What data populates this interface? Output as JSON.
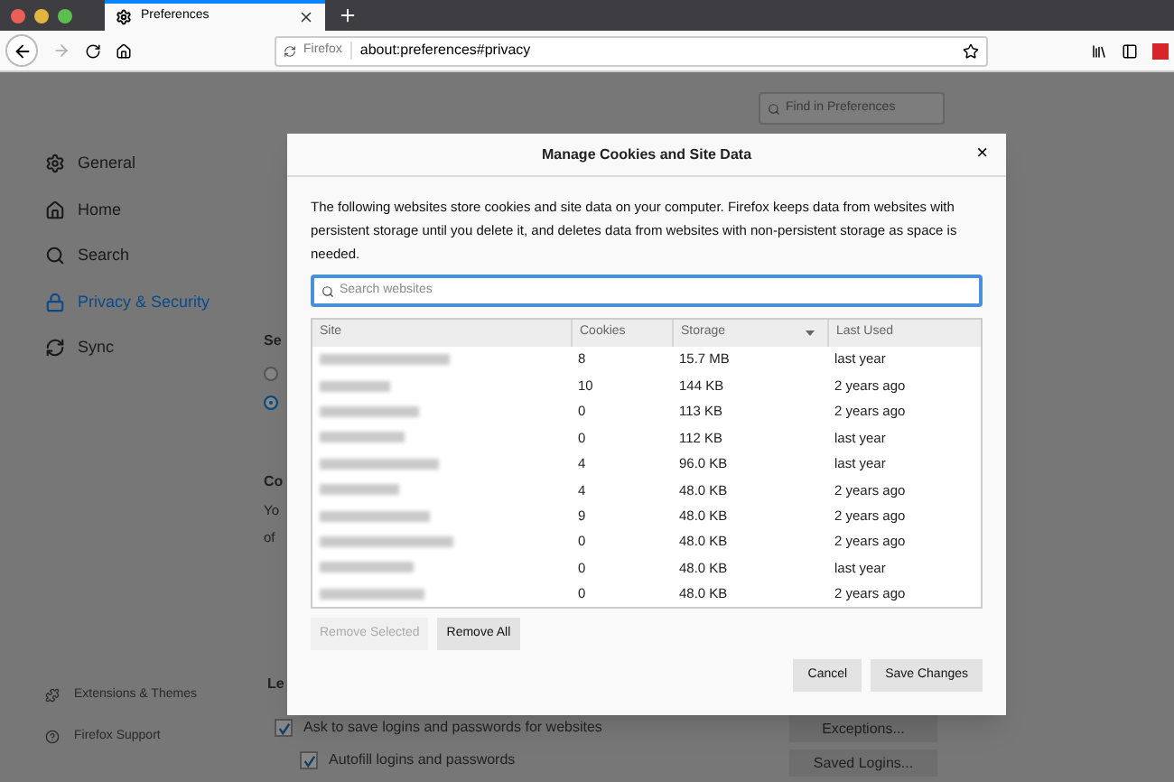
{
  "browser": {
    "tab": {
      "title": "Preferences"
    },
    "identity": "Firefox",
    "url": "about:preferences#privacy"
  },
  "find": {
    "placeholder": "Find in Preferences"
  },
  "sidebar": {
    "items": [
      {
        "label": "General",
        "selected": false
      },
      {
        "label": "Home",
        "selected": false
      },
      {
        "label": "Search",
        "selected": false
      },
      {
        "label": "Privacy & Security",
        "selected": true
      },
      {
        "label": "Sync",
        "selected": false
      }
    ],
    "footer": [
      "Extensions & Themes",
      "Firefox Support"
    ]
  },
  "background": {
    "heading_1": "Se",
    "radios": [
      {
        "selected": false
      },
      {
        "selected": true
      }
    ],
    "heading_2": "Co",
    "text_lines": [
      "Yo",
      "of"
    ],
    "heading_3": "Le",
    "logins": [
      {
        "label": "Ask to save logins and passwords for websites",
        "checked": true
      },
      {
        "label": "Autofill logins and passwords",
        "checked": true
      }
    ],
    "buttons": [
      "Exceptions...",
      "Saved Logins..."
    ]
  },
  "dialog": {
    "title": "Manage Cookies and Site Data",
    "close": "×",
    "description": "The following websites store cookies and site data on your computer. Firefox keeps data from websites with persistent storage until you delete it, and deletes data from websites with non-persistent storage as space is needed.",
    "search": {
      "placeholder": "Search websites"
    },
    "columns": [
      {
        "label": "Site",
        "sorted": false
      },
      {
        "label": "Cookies",
        "sorted": false
      },
      {
        "label": "Storage",
        "sorted": true
      },
      {
        "label": "Last Used",
        "sorted": false
      }
    ],
    "rows": [
      {
        "cookies": "8",
        "storage": "15.7 MB",
        "last_used": "last year"
      },
      {
        "cookies": "10",
        "storage": "144 KB",
        "last_used": "2 years ago"
      },
      {
        "cookies": "0",
        "storage": "113 KB",
        "last_used": "2 years ago"
      },
      {
        "cookies": "0",
        "storage": "112 KB",
        "last_used": "last year"
      },
      {
        "cookies": "4",
        "storage": "96.0 KB",
        "last_used": "last year"
      },
      {
        "cookies": "4",
        "storage": "48.0 KB",
        "last_used": "2 years ago"
      },
      {
        "cookies": "9",
        "storage": "48.0 KB",
        "last_used": "2 years ago"
      },
      {
        "cookies": "0",
        "storage": "48.0 KB",
        "last_used": "2 years ago"
      },
      {
        "cookies": "0",
        "storage": "48.0 KB",
        "last_used": "last year"
      },
      {
        "cookies": "0",
        "storage": "48.0 KB",
        "last_used": "2 years ago"
      }
    ],
    "list_buttons": [
      {
        "label": "Remove Selected",
        "disabled": true
      },
      {
        "label": "Remove All",
        "disabled": false
      }
    ],
    "footer_buttons": [
      "Cancel",
      "Save Changes"
    ]
  }
}
